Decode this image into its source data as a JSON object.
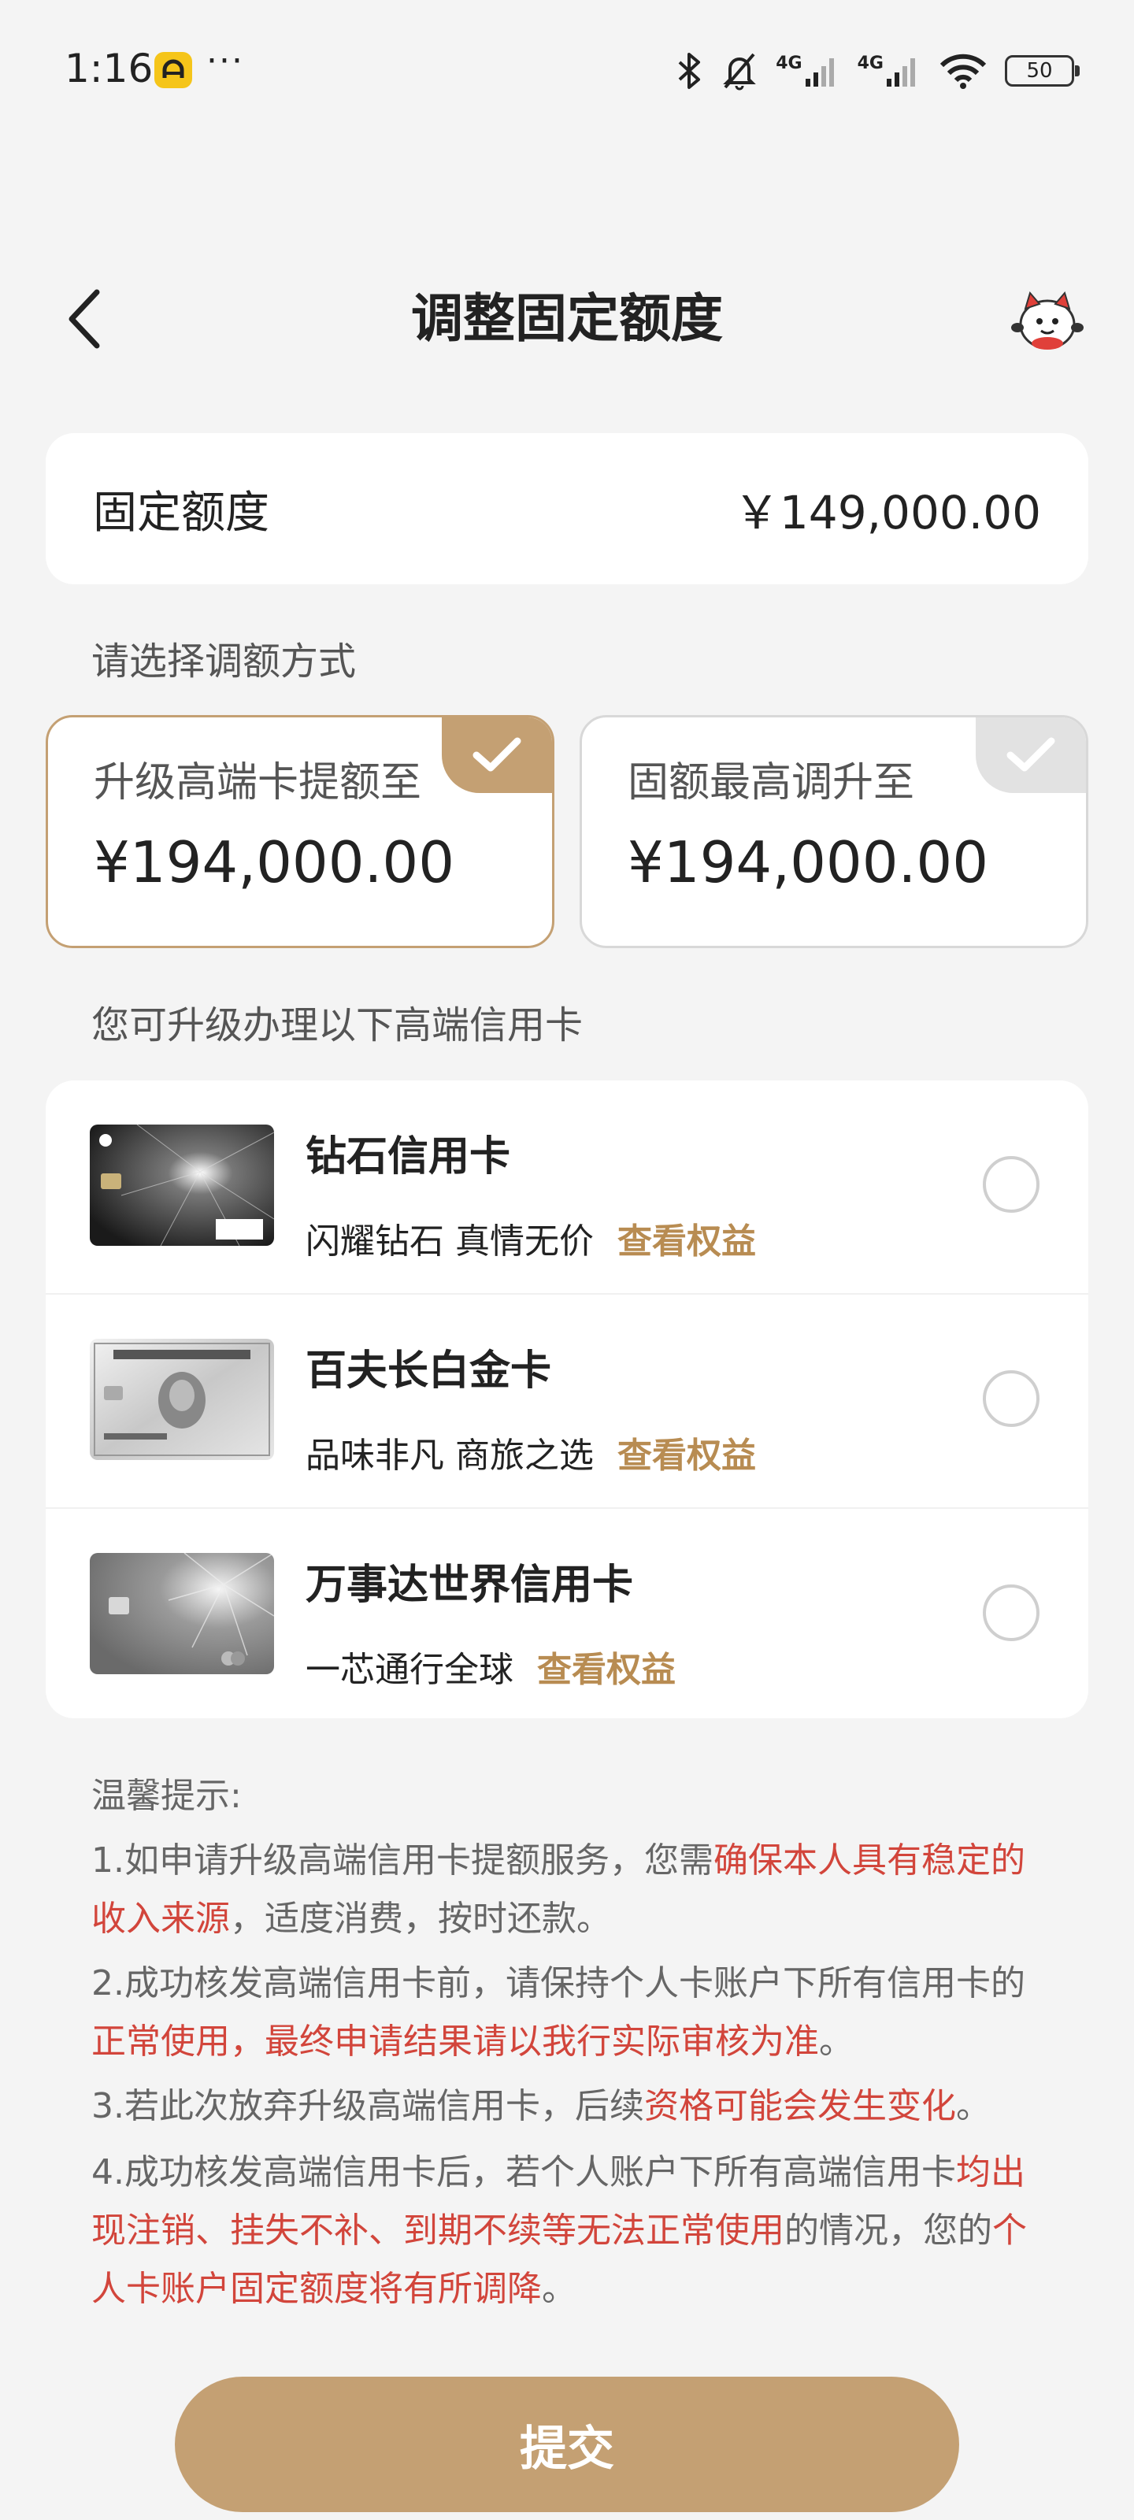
{
  "status_bar": {
    "time": "1:16",
    "dots": "···",
    "net1": "4G",
    "net2": "4G",
    "battery": "50"
  },
  "header": {
    "title": "调整固定额度",
    "back_icon": "chevron-left-icon",
    "mascot_icon": "mascot-icon"
  },
  "limit": {
    "label": "固定额度",
    "value": "￥149,000.00"
  },
  "choose_label": "请选择调额方式",
  "options": [
    {
      "title": "升级高端卡提额至",
      "amount": "¥194,000.00",
      "selected": true
    },
    {
      "title": "固额最高调升至",
      "amount": "¥194,000.00",
      "selected": false
    }
  ],
  "upgrade_label": "您可升级办理以下高端信用卡",
  "cards": [
    {
      "name": "钻石信用卡",
      "desc": "闪耀钻石 真情无价",
      "link": "查看权益"
    },
    {
      "name": "百夫长白金卡",
      "desc": "品味非凡 商旅之选",
      "link": "查看权益"
    },
    {
      "name": "万事达世界信用卡",
      "desc": "一芯通行全球",
      "link": "查看权益"
    }
  ],
  "tips": {
    "title": "温馨提示:",
    "t1a": "1.如申请升级高端信用卡提额服务，您需",
    "t1b": "确保本人具有稳定的收入来源",
    "t1c": "，适度消费，按时还款。",
    "t2a": "2.成功核发高端信用卡前，请保持个人卡账户下所有信用卡的",
    "t2b": "正常使用，最终申请结果请以我行实际审核为准",
    "t2c": "。",
    "t3a": "3.若此次放弃升级高端信用卡，后续",
    "t3b": "资格可能会发生变化",
    "t3c": "。",
    "t4a": "4.成功核发高端信用卡后，若个人账户下所有高端信用卡",
    "t4b": "均出现注销、挂失不补、到期不续等无法正常使用",
    "t4c": "的情况，您的",
    "t4d": "个人卡账户固定额度将有所调降",
    "t4e": "。"
  },
  "submit_label": "提交",
  "colors": {
    "accent": "#c4a073",
    "link": "#b88c52",
    "warning": "#d2453b",
    "background": "#f4f4f4"
  }
}
